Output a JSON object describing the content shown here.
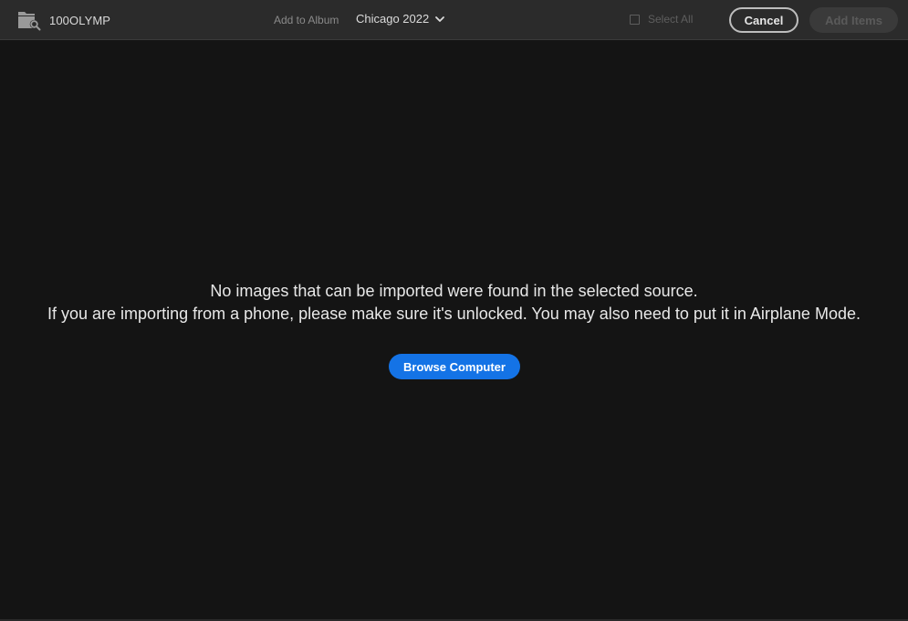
{
  "header": {
    "source_name": "100OLYMP",
    "source_icon": "folder-search-icon",
    "add_to_album_label": "Add to Album",
    "album_selected": "Chicago 2022",
    "album_chevron_icon": "chevron-down-icon",
    "select_all_label": "Select All",
    "select_all_checked": false,
    "cancel_label": "Cancel",
    "add_items_label": "Add Items",
    "add_items_enabled": false
  },
  "empty_state": {
    "line1": "No images that can be imported were found in the selected source.",
    "line2": "If you are importing from a phone, please make sure it's unlocked. You may also need to put it in Airplane Mode.",
    "browse_label": "Browse Computer"
  },
  "colors": {
    "background": "#141414",
    "topbar": "#2b2b2b",
    "accent_blue": "#1473e6",
    "disabled_button": "#3a3a3a"
  }
}
